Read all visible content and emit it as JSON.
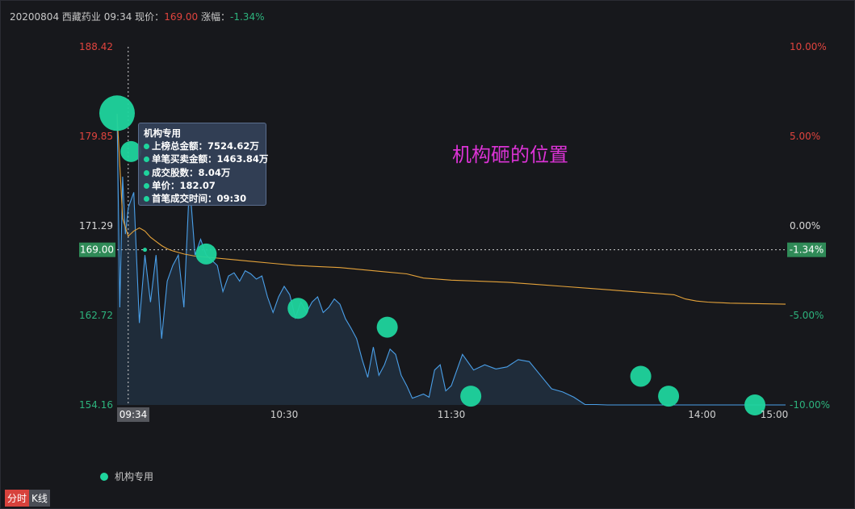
{
  "header": {
    "date": "20200804",
    "name": "西藏药业",
    "time": "09:34",
    "price_label": "现价：",
    "price": "169.00",
    "change_label": "涨幅：",
    "change": "-1.34%"
  },
  "annotation": "机构砸的位置",
  "tooltip": {
    "title": "机构专用",
    "rows": [
      "上榜总金额：7524.62万",
      "单笔买卖金额：1463.84万",
      "成交股数：8.04万",
      "单价：182.07",
      "首笔成交时间：09:30"
    ]
  },
  "legend": {
    "label": "机构专用"
  },
  "tabs": [
    {
      "label": "分时",
      "active": true
    },
    {
      "label": "K线",
      "active": false
    }
  ],
  "colors": {
    "price_line": "#4a9fe8",
    "avg_line": "#e5a33a",
    "marker": "#1fd49d",
    "up": "#e0443e",
    "down": "#2db37d",
    "annotation": "#dc33d6"
  },
  "chart_data": {
    "type": "line",
    "ylim": [
      154.16,
      188.42
    ],
    "y_ticks": [
      {
        "value": 188.42,
        "label": "188.42",
        "pct": "10.00%",
        "color": "up"
      },
      {
        "value": 179.85,
        "label": "179.85",
        "pct": "5.00%",
        "color": "up"
      },
      {
        "value": 171.29,
        "label": "171.29",
        "pct": "0.00%",
        "color": "neutral"
      },
      {
        "value": 162.72,
        "label": "162.72",
        "pct": "-5.00%",
        "color": "down"
      },
      {
        "value": 154.16,
        "label": "154.16",
        "pct": "-10.00%",
        "color": "down"
      }
    ],
    "x_ticks": [
      "10:30",
      "11:30",
      "14:00",
      "15:00"
    ],
    "session_minutes": 240,
    "crosshair": {
      "time": "09:34",
      "minute": 4,
      "price": "169.00",
      "price_value": 169.0,
      "change": "-1.34%"
    },
    "series": [
      {
        "key": "price",
        "minutes": [
          0,
          1,
          2,
          3,
          4,
          6,
          8,
          10,
          12,
          14,
          16,
          18,
          20,
          22,
          24,
          26,
          28,
          30,
          32,
          34,
          36,
          38,
          40,
          42,
          44,
          46,
          48,
          50,
          52,
          54,
          56,
          58,
          60,
          62,
          64,
          66,
          68,
          70,
          72,
          74,
          76,
          78,
          80,
          82,
          84,
          86,
          88,
          90,
          92,
          94,
          96,
          98,
          100,
          102,
          104,
          106,
          108,
          110,
          112,
          114,
          116,
          118,
          120,
          124,
          128,
          132,
          136,
          140,
          144,
          148,
          152,
          156,
          160,
          164,
          168,
          172,
          176,
          180,
          184,
          188,
          192,
          196,
          200,
          204,
          208,
          212,
          216,
          220,
          224,
          228,
          232,
          236,
          240
        ],
        "values": [
          182.0,
          163.5,
          176.0,
          170.5,
          173.0,
          174.5,
          162.0,
          168.5,
          164.0,
          168.5,
          160.5,
          166.0,
          167.5,
          168.5,
          163.5,
          175.5,
          168.5,
          170.0,
          168.5,
          168.0,
          167.5,
          165.0,
          166.5,
          166.8,
          166.0,
          167.0,
          166.7,
          166.2,
          166.5,
          164.5,
          163.0,
          164.5,
          165.5,
          164.7,
          162.5,
          164.0,
          163.0,
          164.0,
          164.5,
          163.0,
          163.5,
          164.3,
          163.8,
          162.4,
          161.5,
          160.5,
          158.5,
          156.8,
          159.7,
          157.0,
          158.0,
          159.5,
          159.0,
          157.0,
          156.0,
          154.8,
          155.0,
          155.2,
          154.9,
          157.5,
          158.0,
          155.5,
          156.0,
          159.0,
          157.5,
          158.0,
          157.6,
          157.8,
          158.5,
          158.3,
          157.0,
          155.7,
          155.4,
          154.9,
          154.2,
          154.2,
          154.16,
          154.16,
          154.16,
          154.16,
          154.16,
          154.16,
          154.16,
          154.16,
          154.16,
          154.16,
          154.16,
          154.16,
          154.16,
          154.16,
          154.16,
          154.16,
          154.16
        ]
      },
      {
        "key": "avg",
        "minutes": [
          0,
          2,
          4,
          6,
          8,
          10,
          12,
          14,
          16,
          18,
          20,
          24,
          28,
          32,
          36,
          40,
          48,
          56,
          64,
          72,
          80,
          88,
          96,
          104,
          110,
          120,
          130,
          140,
          150,
          160,
          170,
          180,
          190,
          200,
          204,
          208,
          212,
          220,
          230,
          240
        ],
        "values": [
          182.0,
          172.0,
          170.3,
          170.8,
          171.1,
          170.8,
          170.2,
          169.8,
          169.4,
          169.1,
          168.9,
          168.6,
          168.4,
          168.3,
          168.2,
          168.1,
          167.9,
          167.7,
          167.5,
          167.4,
          167.3,
          167.1,
          166.9,
          166.7,
          166.3,
          166.1,
          166.0,
          165.9,
          165.7,
          165.5,
          165.3,
          165.1,
          164.9,
          164.7,
          164.3,
          164.1,
          164.0,
          163.9,
          163.85,
          163.8
        ]
      }
    ],
    "markers": [
      {
        "minute": 0,
        "price": 182.07,
        "size": "large"
      },
      {
        "minute": 5,
        "price": 178.4
      },
      {
        "minute": 32,
        "price": 168.6
      },
      {
        "minute": 65,
        "price": 163.4
      },
      {
        "minute": 97,
        "price": 161.6
      },
      {
        "minute": 127,
        "price": 155.0
      },
      {
        "minute": 188,
        "price": 156.9
      },
      {
        "minute": 198,
        "price": 155.0
      },
      {
        "minute": 229,
        "price": 154.16
      }
    ]
  }
}
